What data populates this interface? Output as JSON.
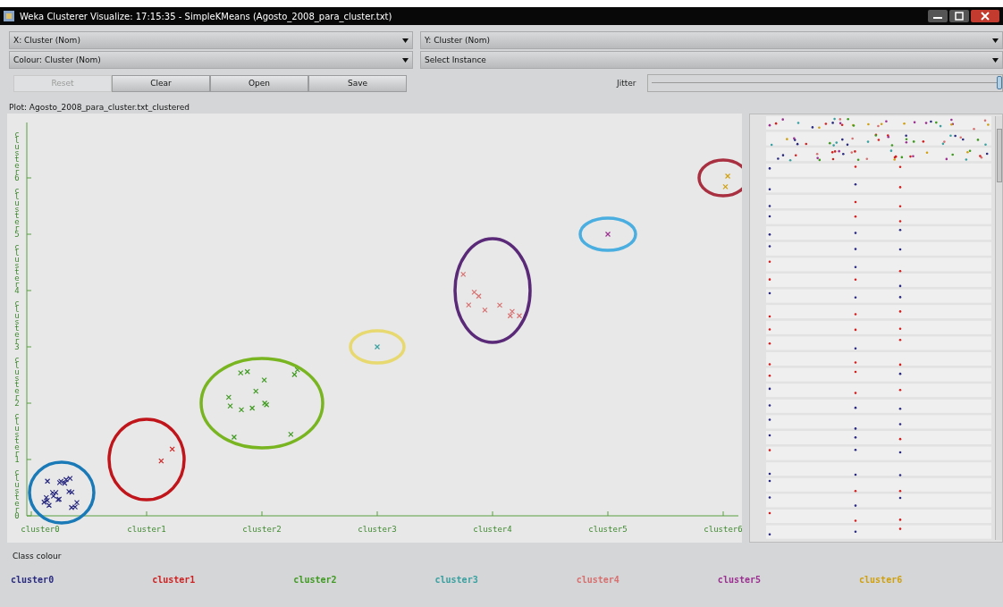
{
  "window": {
    "title": "Weka Clusterer Visualize: 17:15:35 - SimpleKMeans (Agosto_2008_para_cluster.txt)"
  },
  "selectors": [
    {
      "label": "X: Cluster (Nom)"
    },
    {
      "label": "Y: Cluster (Nom)"
    },
    {
      "label": "Colour: Cluster (Nom)"
    },
    {
      "label": "Select Instance"
    }
  ],
  "buttons": [
    {
      "label": "Reset",
      "disabled": true
    },
    {
      "label": "Clear",
      "disabled": false
    },
    {
      "label": "Open",
      "disabled": false
    },
    {
      "label": "Save",
      "disabled": false
    }
  ],
  "jitter": {
    "label": "Jitter",
    "level": 1.0
  },
  "plot": {
    "title": "Plot: Agosto_2008_para_cluster.txt_clustered",
    "x_labels": [
      "cluster0",
      "cluster1",
      "cluster2",
      "cluster3",
      "cluster4",
      "cluster5",
      "cluster6"
    ],
    "clusters": [
      {
        "color": "#2a2a80"
      },
      {
        "color": "#d02020"
      },
      {
        "color": "#3f9a20"
      },
      {
        "color": "#3aa0a0"
      },
      {
        "color": "#d87070"
      },
      {
        "color": "#9b3090"
      },
      {
        "color": "#d0a010"
      }
    ],
    "highlights": [
      {
        "color": "#1a7ab8"
      },
      {
        "color": "#c0161b"
      },
      {
        "color": "#78b520"
      },
      {
        "color": "#e8d870"
      },
      {
        "color": "#5a2a78"
      },
      {
        "color": "#4aaee0"
      },
      {
        "color": "#a83040"
      }
    ],
    "y_labels": [
      "cluster6",
      "cluster5",
      "cluster4",
      "cluster3",
      "cluster2",
      "cluster1",
      "cluster0"
    ],
    "legend_title": "Class colour",
    "legend": [
      {
        "label": "cluster0",
        "color": "#2a2a80"
      },
      {
        "label": "cluster1",
        "color": "#d02020"
      },
      {
        "label": "cluster2",
        "color": "#3f9a20"
      },
      {
        "label": "cluster3",
        "color": "#3aa0a0"
      },
      {
        "label": "cluster4",
        "color": "#d87070"
      },
      {
        "label": "cluster5",
        "color": "#9b3090"
      },
      {
        "label": "cluster6",
        "color": "#d0a010"
      }
    ]
  },
  "attribute_panel": {
    "kind": "strips"
  }
}
